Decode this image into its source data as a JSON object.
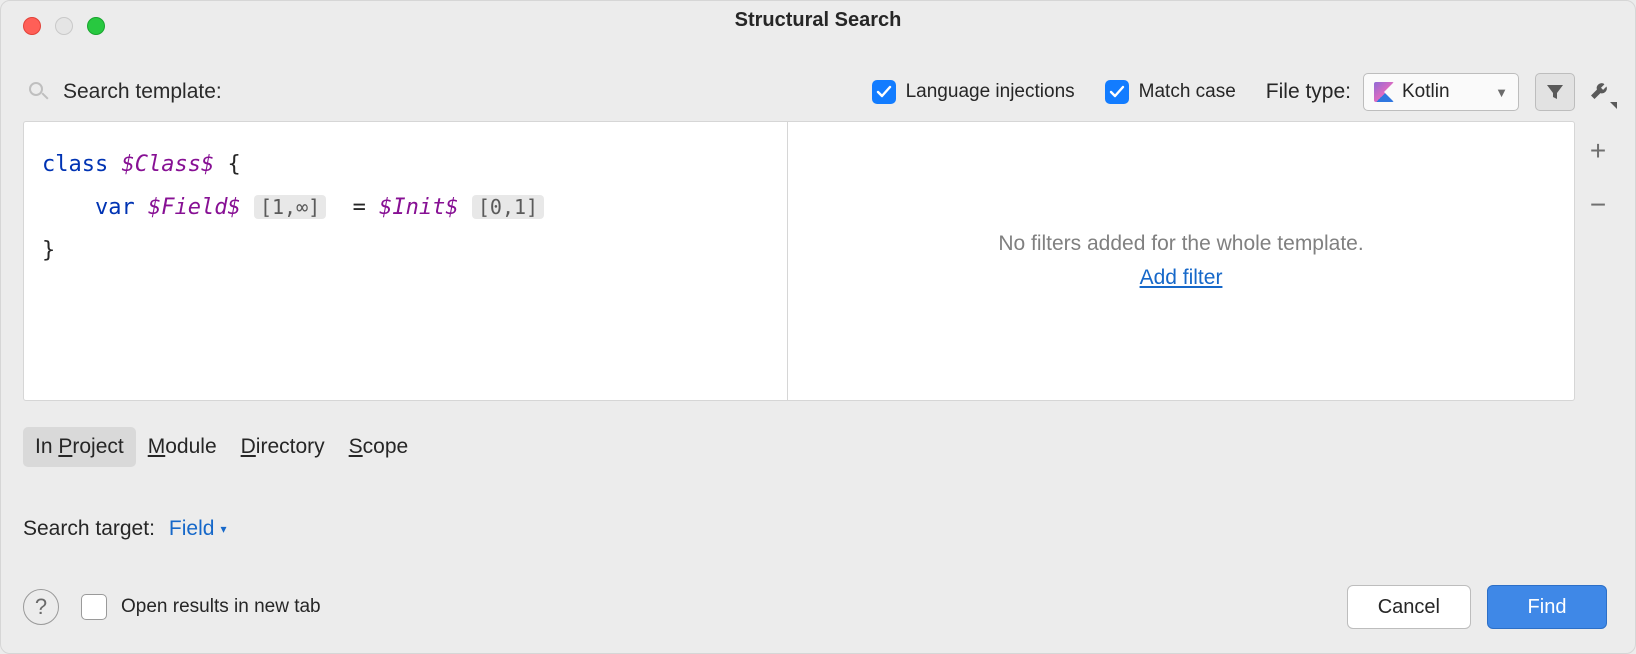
{
  "title": "Structural Search",
  "toolbar": {
    "search_template_label": "Search template:",
    "lang_inj_label": "Language injections",
    "match_case_label": "Match case",
    "file_type_label": "File type:",
    "file_type_value": "Kotlin"
  },
  "template": {
    "kw_class": "class",
    "var_class": "$Class$",
    "brace_open": " {",
    "indent": "    ",
    "kw_var": "var",
    "var_field": "$Field$",
    "hint_field": "[1,∞]",
    "eq": "  = ",
    "var_init": "$Init$",
    "hint_init": "[0,1]",
    "brace_close": "}"
  },
  "filters": {
    "empty_msg": "No filters added for the whole template.",
    "add_link": "Add filter"
  },
  "side": {
    "plus": "+",
    "minus": "−"
  },
  "scopes": {
    "project_pre": "In ",
    "project_u": "P",
    "project_post": "roject",
    "module_u": "M",
    "module_post": "odule",
    "directory_u": "D",
    "directory_post": "irectory",
    "scope_u": "S",
    "scope_post": "cope"
  },
  "search_target": {
    "label": "Search target:",
    "value": "Field"
  },
  "bottom": {
    "help": "?",
    "open_new_tab": "Open results in new tab",
    "cancel": "Cancel",
    "find": "Find"
  }
}
